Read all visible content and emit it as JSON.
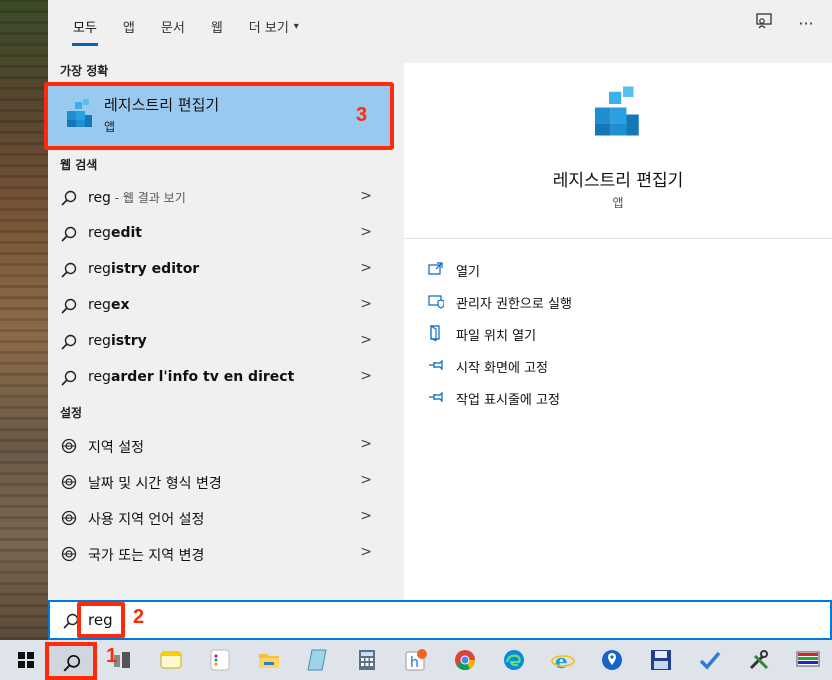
{
  "tabs": [
    {
      "label": "모두",
      "active": true
    },
    {
      "label": "앱"
    },
    {
      "label": "문서"
    },
    {
      "label": "웹"
    },
    {
      "label": "더 보기",
      "caret": "▾"
    }
  ],
  "top_icons": {
    "feedback": "feedback-icon",
    "more": "···"
  },
  "sections": {
    "best_match": "가장 정확",
    "web_search": "웹 검색",
    "settings": "설정"
  },
  "best_match": {
    "title": "레지스트리 편집기",
    "subtitle": "앱",
    "step": "3"
  },
  "web_results": [
    {
      "prefix": "reg",
      "bold": "",
      "suffix": " - 웹 결과 보기",
      "style": "dim"
    },
    {
      "prefix": "reg",
      "bold": "edit"
    },
    {
      "prefix": "reg",
      "bold": "istry editor"
    },
    {
      "prefix": "reg",
      "bold": "ex"
    },
    {
      "prefix": "reg",
      "bold": "istry"
    },
    {
      "prefix": "reg",
      "bold": "arder l'info tv en direct"
    }
  ],
  "settings_results": [
    {
      "label": "지역 설정"
    },
    {
      "label": "날짜 및 시간 형식 변경"
    },
    {
      "label": "사용 지역 언어 설정"
    },
    {
      "label": "국가 또는 지역 변경"
    }
  ],
  "preview": {
    "name": "레지스트리 편집기",
    "type": "앱",
    "actions": [
      {
        "label": "열기",
        "icon": "open-icon"
      },
      {
        "label": "관리자 권한으로 실행",
        "icon": "shield-icon"
      },
      {
        "label": "파일 위치 열기",
        "icon": "file-location-icon"
      },
      {
        "label": "시작 화면에 고정",
        "icon": "pin-icon"
      },
      {
        "label": "작업 표시줄에 고정",
        "icon": "pin-icon"
      }
    ]
  },
  "search": {
    "query": "reg",
    "step": "2"
  },
  "taskbar": {
    "step": "1",
    "chevron": ">"
  },
  "colors": {
    "accent": "#0067c0",
    "selection": "#99c9ef",
    "annotation": "#ff2a0a"
  }
}
